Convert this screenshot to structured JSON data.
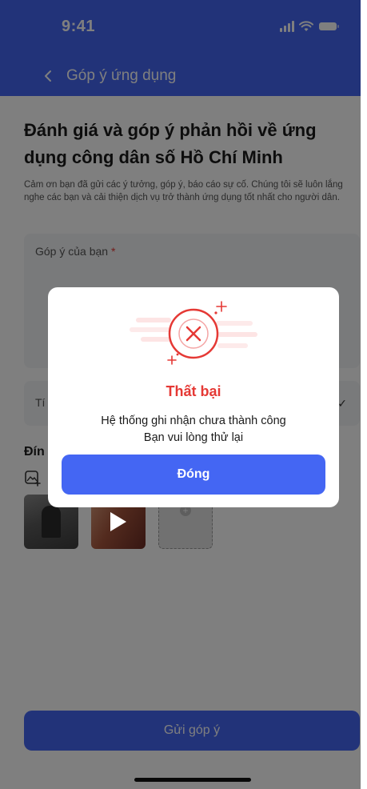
{
  "status_bar": {
    "time": "9:41",
    "icons": [
      "signal-icon",
      "wifi-icon",
      "battery-icon"
    ]
  },
  "header": {
    "back_icon": "chevron-left-icon",
    "title": "Góp ý ứng dụng"
  },
  "page": {
    "title": "Đánh giá và góp ý phản hồi về ứng dụng công dân số Hồ Chí Minh",
    "description": "Cảm ơn bạn đã gửi các ý tưởng, góp ý, báo cáo sự cố. Chúng tôi sẽ luôn lắng nghe các bạn và cải thiện dịch vụ trở thành ứng dụng tốt nhất cho người dân.",
    "feedback_label": "Góp ý của bạn",
    "required_mark": "*",
    "select_label_partial": "Tí",
    "attach_title_partial": "Đín",
    "submit_label": "Gửi góp ý"
  },
  "dialog": {
    "icon": "error-x-icon",
    "title": "Thất bại",
    "message_line1": "Hệ thống ghi nhận chưa thành công",
    "message_line2": "Bạn vui lòng thử lại",
    "close_label": "Đóng"
  },
  "colors": {
    "primary": "#4466f3",
    "error": "#e53935"
  }
}
